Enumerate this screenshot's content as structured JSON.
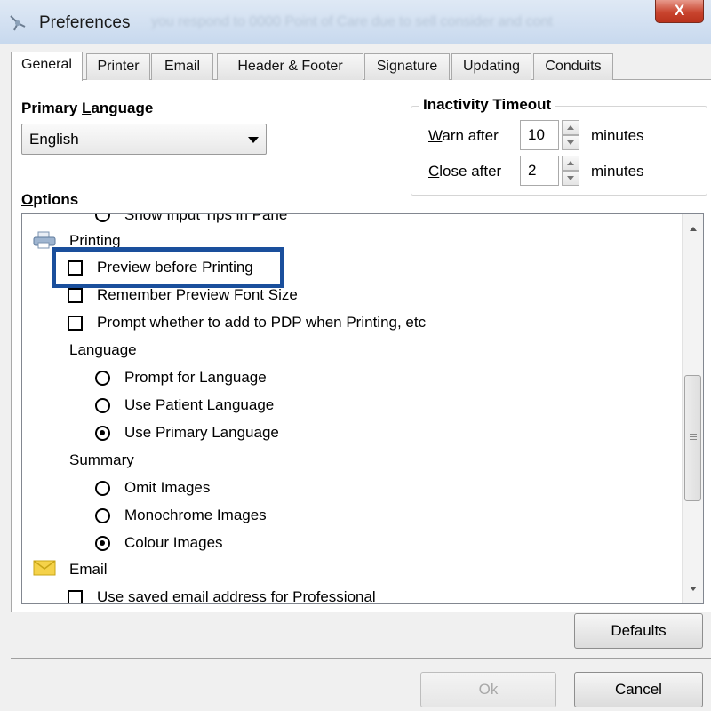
{
  "window": {
    "title": "Preferences",
    "title_hint": "you respond to 0000 Point of Care due to sell consider and cont",
    "close_label": "X"
  },
  "tabs": [
    "General",
    "Printer",
    "Email",
    "Header & Footer",
    "Signature",
    "Updating",
    "Conduits"
  ],
  "active_tab": "General",
  "primary_language": {
    "label_prefix": "Primary ",
    "label_accel": "L",
    "label_rest": "anguage",
    "value": "English"
  },
  "inactivity": {
    "title": "Inactivity Timeout",
    "warn_accel": "W",
    "warn_rest": "arn after",
    "warn_value": "10",
    "close_accel": "C",
    "close_rest": "lose after",
    "close_value": "2",
    "unit": "minutes"
  },
  "options": {
    "label_accel": "O",
    "label_rest": "ptions",
    "partial_item": "Show Input Tips in Pane",
    "printing": {
      "label": "Printing",
      "items": [
        {
          "label": "Preview before Printing",
          "checked": false
        },
        {
          "label": "Remember Preview Font Size",
          "checked": false
        },
        {
          "label": "Prompt whether to add to PDP when Printing, etc",
          "checked": false
        }
      ]
    },
    "language": {
      "label": "Language",
      "items": [
        {
          "label": "Prompt for Language",
          "selected": false
        },
        {
          "label": "Use Patient Language",
          "selected": false
        },
        {
          "label": "Use Primary Language",
          "selected": true
        }
      ]
    },
    "summary": {
      "label": "Summary",
      "items": [
        {
          "label": "Omit Images",
          "selected": false
        },
        {
          "label": "Monochrome Images",
          "selected": false
        },
        {
          "label": "Colour Images",
          "selected": true
        }
      ]
    },
    "email": {
      "label": "Email",
      "items": [
        {
          "label": "Use saved email address for Professional",
          "checked": false
        }
      ]
    }
  },
  "buttons": {
    "defaults": "Defaults",
    "ok": "Ok",
    "cancel": "Cancel"
  },
  "colors": {
    "highlight": "#1a4f9c",
    "close_button": "#c9452f",
    "titlebar": "#dfe9f5"
  }
}
